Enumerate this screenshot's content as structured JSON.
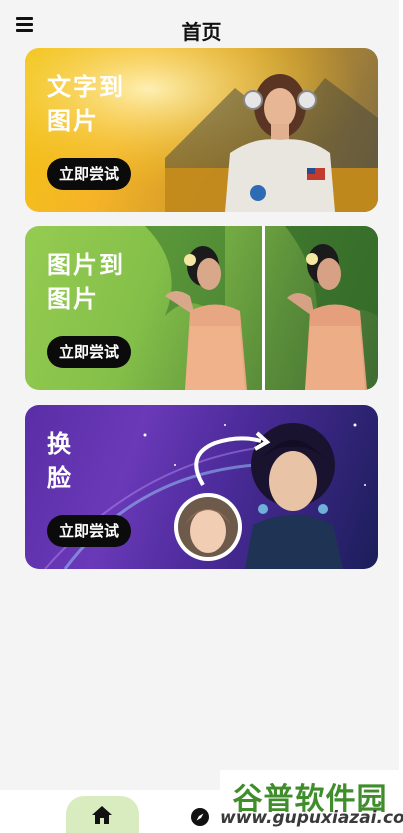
{
  "header": {
    "title": "首页",
    "menu_icon": "hamburger-menu-icon"
  },
  "cards": [
    {
      "label": "文字到\n图片",
      "button": "立即尝试",
      "image": "astronaut-girl-in-field"
    },
    {
      "label": "图片到\n图片",
      "button": "立即尝试",
      "image": "woman-with-flower-before-after"
    },
    {
      "label": "换\n脸",
      "button": "立即尝试",
      "image": "face-swap-galaxy-portrait"
    }
  ],
  "bottom_nav": {
    "items": [
      {
        "name": "home",
        "icon": "home-icon",
        "active": true
      },
      {
        "name": "explore",
        "icon": "compass-icon",
        "active": false
      }
    ]
  },
  "watermark": {
    "cn": "谷普软件园",
    "url": "www.gupuxiazai.com"
  },
  "colors": {
    "accent_nav": "#d9ecbf",
    "card1": "#f2c416",
    "card2": "#95cb51",
    "card3": "#5a2ea6",
    "button_bg": "#0b0b0b"
  }
}
